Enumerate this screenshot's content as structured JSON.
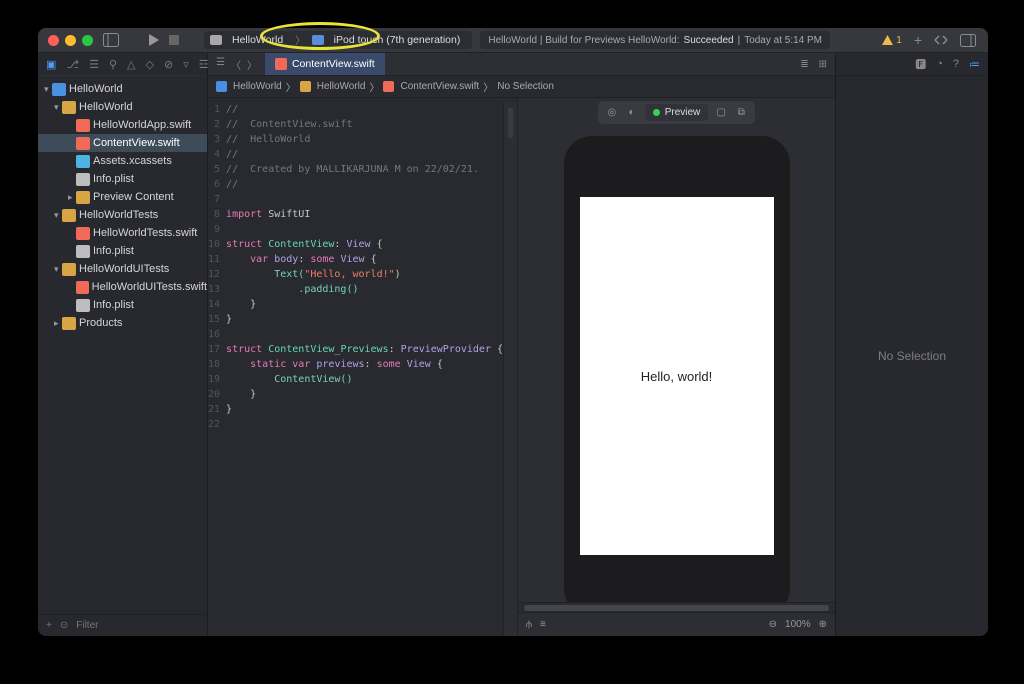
{
  "scheme": {
    "project": "HelloWorld",
    "device": "iPod touch (7th generation)"
  },
  "status": {
    "prefix": "HelloWorld | Build for Previews HelloWorld:",
    "state": "Succeeded",
    "time": "Today at 5:14 PM",
    "warn_count": "1"
  },
  "side_items": {
    "root": "HelloWorld",
    "group1": "HelloWorld",
    "file_app": "HelloWorldApp.swift",
    "file_cv": "ContentView.swift",
    "file_assets": "Assets.xcassets",
    "file_info1": "Info.plist",
    "group_preview": "Preview Content",
    "group_tests": "HelloWorldTests",
    "file_tests": "HelloWorldTests.swift",
    "file_info2": "Info.plist",
    "group_uitests": "HelloWorldUITests",
    "file_uitests": "HelloWorldUITests.swift",
    "file_info3": "Info.plist",
    "group_products": "Products"
  },
  "tab": {
    "file": "ContentView.swift"
  },
  "path": {
    "p1": "HelloWorld",
    "p2": "HelloWorld",
    "p3": "ContentView.swift",
    "p4": "No Selection"
  },
  "preview": {
    "label": "Preview",
    "zoom": "100%",
    "text": "Hello, world!"
  },
  "filter": {
    "placeholder": "Filter"
  },
  "inspector": {
    "empty": "No Selection"
  },
  "code": {
    "l1": "//",
    "l2": "//  ContentView.swift",
    "l3": "//  HelloWorld",
    "l4": "//",
    "l5": "//  Created by MALLIKARJUNA M on 22/02/21.",
    "l6": "//",
    "l8a": "import",
    "l8b": " SwiftUI",
    "l10a": "struct",
    "l10b": " ContentView",
    "l10c": ": ",
    "l10d": "View",
    "l10e": " {",
    "l11a": "    var",
    "l11b": " body",
    "l11c": ": ",
    "l11d": "some",
    "l11e": " View",
    "l11f": " {",
    "l12a": "        Text(",
    "l12b": "\"Hello, world!\"",
    "l12c": ")",
    "l13": "            .padding()",
    "l14": "    }",
    "l15": "}",
    "l17a": "struct",
    "l17b": " ContentView_Previews",
    "l17c": ": ",
    "l17d": "PreviewProvider",
    "l17e": " {",
    "l18a": "    static",
    "l18b": " var",
    "l18c": " previews",
    "l18d": ": ",
    "l18e": "some",
    "l18f": " View",
    "l18g": " {",
    "l19": "        ContentView()",
    "l20": "    }",
    "l21": "}"
  }
}
